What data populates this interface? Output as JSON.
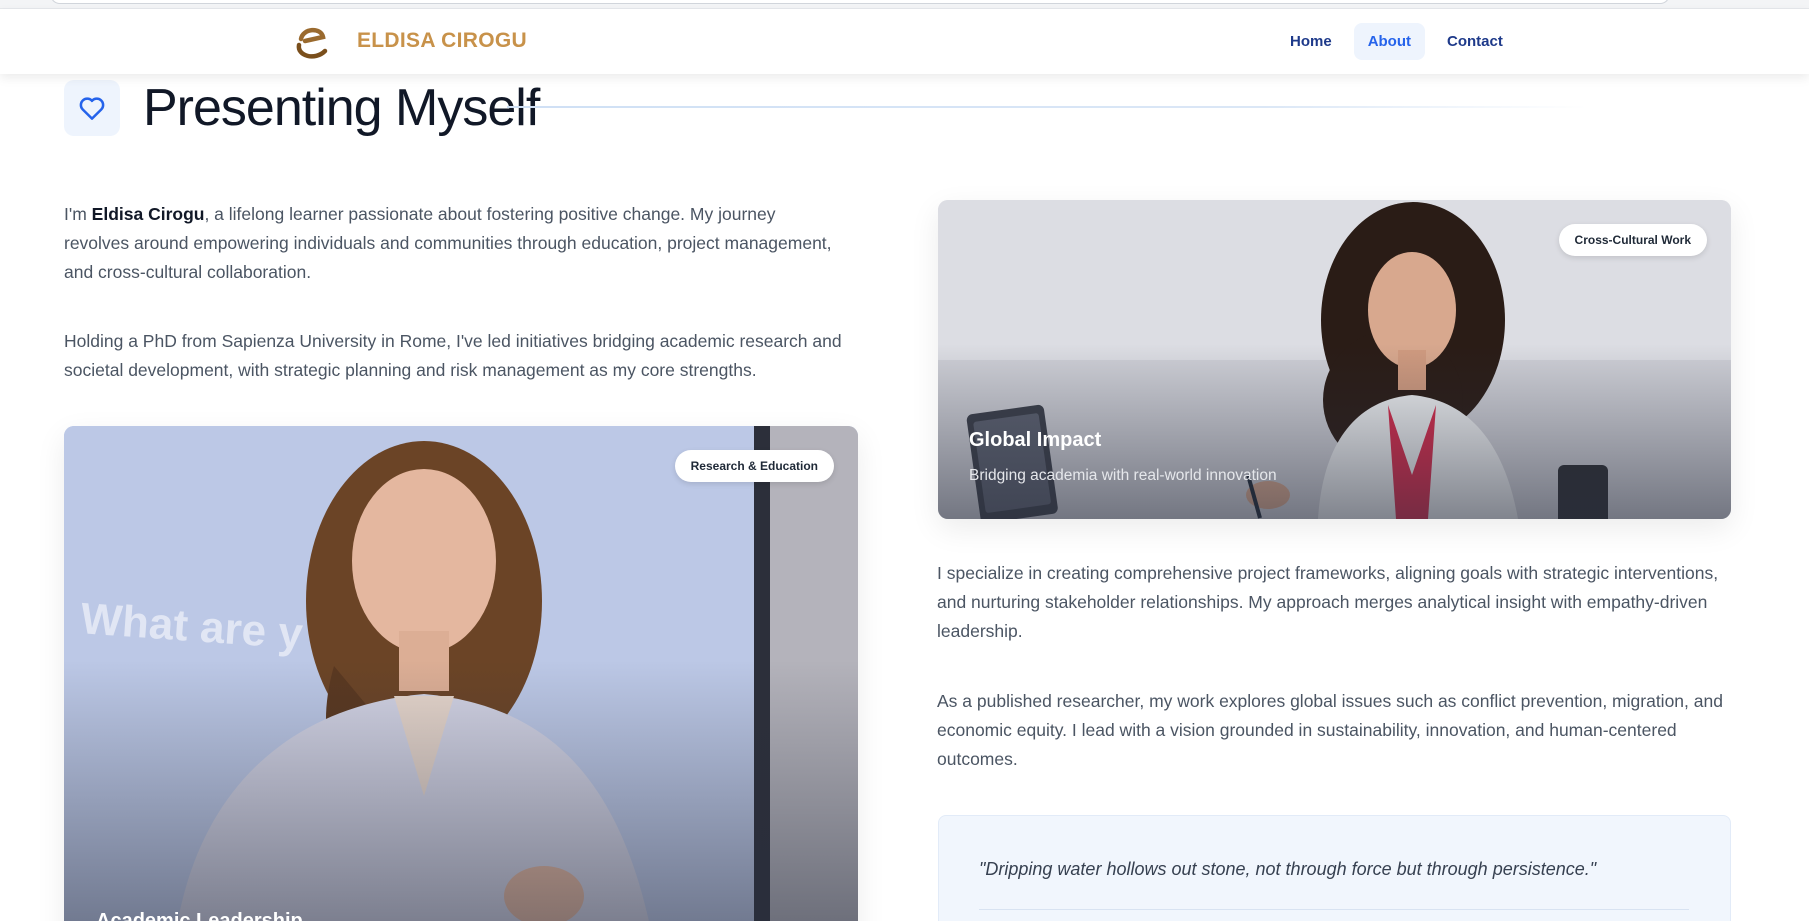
{
  "header": {
    "brand": "ELDISA CIROGU",
    "nav": [
      {
        "label": "Home",
        "active": false
      },
      {
        "label": "About",
        "active": true
      },
      {
        "label": "Contact",
        "active": false
      }
    ]
  },
  "section": {
    "icon": "heart-icon",
    "title": "Presenting Myself"
  },
  "intro": {
    "prefix": "I'm ",
    "name": "Eldisa Cirogu",
    "rest": ", a lifelong learner passionate about fostering positive change. My journey revolves around empowering individuals and communities through education, project management, and cross-cultural collaboration."
  },
  "paragraph_2": "Holding a PhD from Sapienza University in Rome, I've led initiatives bridging academic research and societal development, with strategic planning and risk management as my core strengths.",
  "paragraph_3": "I specialize in creating comprehensive project frameworks, aligning goals with strategic interventions, and nurturing stakeholder relationships. My approach merges analytical insight with empathy-driven leadership.",
  "paragraph_4": "As a published researcher, my work explores global issues such as conflict prevention, migration, and economic equity. I lead with a vision grounded in sustainability, innovation, and human-centered outcomes.",
  "card_right": {
    "badge": "Cross-Cultural Work",
    "title": "Global Impact",
    "subtitle": "Bridging academia with real-world innovation"
  },
  "card_left": {
    "badge": "Research & Education",
    "title": "Academic Leadership"
  },
  "quote": "\"Dripping water hollows out stone, not through force but through persistence.\"",
  "colors": {
    "brand": "#c8924a",
    "nav_text": "#1e3a8a",
    "nav_active_bg": "#eef4fd",
    "accent": "#2563eb"
  }
}
